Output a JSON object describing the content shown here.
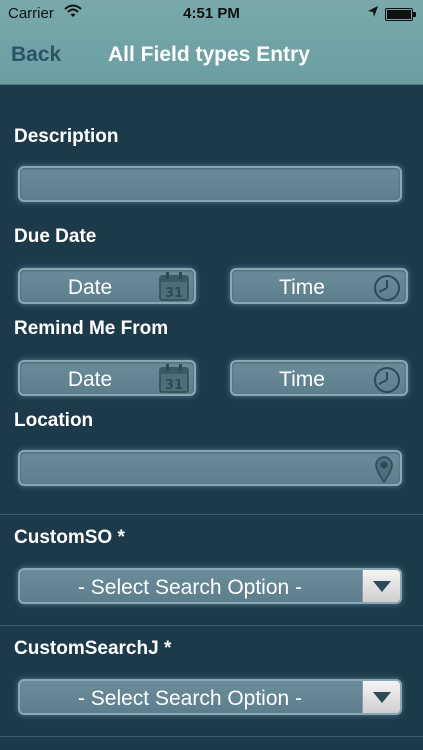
{
  "status_bar": {
    "carrier": "Carrier",
    "time": "4:51 PM"
  },
  "nav": {
    "back_label": "Back",
    "title": "All Field types Entry"
  },
  "form": {
    "description_label": "Description",
    "due_date_label": "Due Date",
    "remind_label": "Remind Me From",
    "location_label": "Location",
    "date_label": "Date",
    "time_label": "Time",
    "calendar_day": "31",
    "custom_so_label": "CustomSO *",
    "custom_search_label": "CustomSearchJ *",
    "select_placeholder": "- Select Search Option -"
  },
  "colors": {
    "background": "#1d3a4b",
    "navbar": "#6fa3a6",
    "field": "#62838f",
    "back": "#2a5363"
  }
}
